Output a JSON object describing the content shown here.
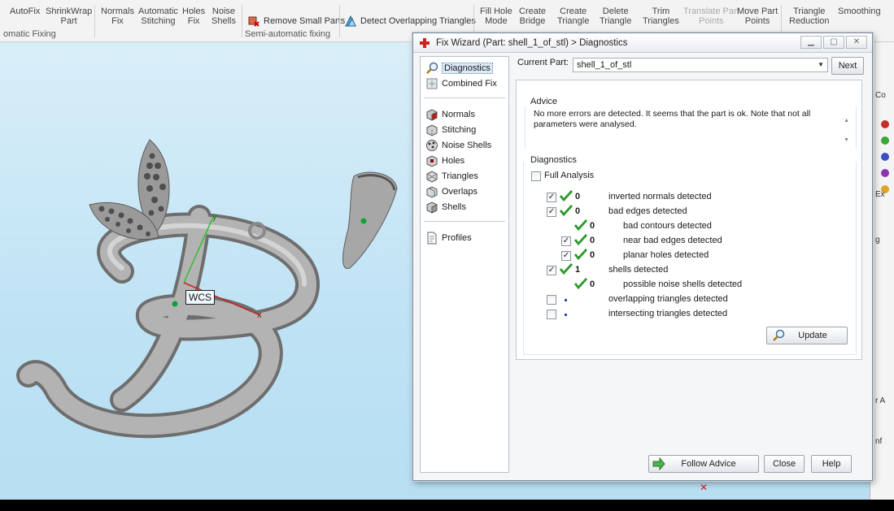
{
  "ribbon": {
    "autofix": "AutoFix",
    "shrinkwrap": "ShrinkWrap\nPart",
    "normals_fix": "Normals\nFix",
    "auto_stitch": "Automatic\nStitching",
    "holes_fix": "Holes\nFix",
    "noise_shells": "Noise\nShells",
    "remove_small_parts": "Remove Small Parts",
    "detect_overlapping": "Detect Overlapping Triangles",
    "fill_hole_mode": "Fill Hole\nMode",
    "create_bridge": "Create\nBridge",
    "create_triangle": "Create\nTriangle",
    "delete_triangle": "Delete\nTriangle",
    "trim_triangles": "Trim\nTriangles",
    "translate_part_points": "Translate Part\nPoints",
    "move_part_points": "Move Part\nPoints",
    "triangle_reduction": "Triangle\nReduction",
    "smoothing": "Smoothing",
    "group_auto": "omatic Fixing",
    "group_semi": "Semi-automatic fixing"
  },
  "viewport": {
    "wcs_label": "WCS",
    "axis_y": "y",
    "axis_x": "x"
  },
  "side_panel": {
    "labels": [
      "Co",
      "Ex",
      "g",
      "r A",
      "nf"
    ]
  },
  "dialog": {
    "title": "Fix Wizard (Part: shell_1_of_stl) > Diagnostics",
    "current_part_label": "Current Part:",
    "current_part_value": "shell_1_of_stl",
    "next_button": "Next",
    "nav": {
      "diagnostics": "Diagnostics",
      "combined_fix": "Combined Fix",
      "normals": "Normals",
      "stitching": "Stitching",
      "noise_shells": "Noise Shells",
      "holes": "Holes",
      "triangles": "Triangles",
      "overlaps": "Overlaps",
      "shells": "Shells",
      "profiles": "Profiles"
    },
    "advice_title": "Advice",
    "advice_text": "No more errors are detected. It seems that the part is ok. Note that not all parameters were analysed.",
    "diagnostics_title": "Diagnostics",
    "full_analysis": "Full Analysis",
    "rows": [
      {
        "count": "0",
        "label": "inverted normals detected"
      },
      {
        "count": "0",
        "label": "bad edges detected"
      },
      {
        "count": "0",
        "label": "bad contours detected"
      },
      {
        "count": "0",
        "label": "near bad edges detected"
      },
      {
        "count": "0",
        "label": "planar holes detected"
      },
      {
        "count": "1",
        "label": "shells detected"
      },
      {
        "count": "0",
        "label": "possible noise shells detected"
      },
      {
        "count": "",
        "label": "overlapping triangles detected"
      },
      {
        "count": "",
        "label": "intersecting triangles detected"
      }
    ],
    "update_button": "Update",
    "follow_advice_button": "Follow Advice",
    "close_button": "Close",
    "help_button": "Help"
  }
}
